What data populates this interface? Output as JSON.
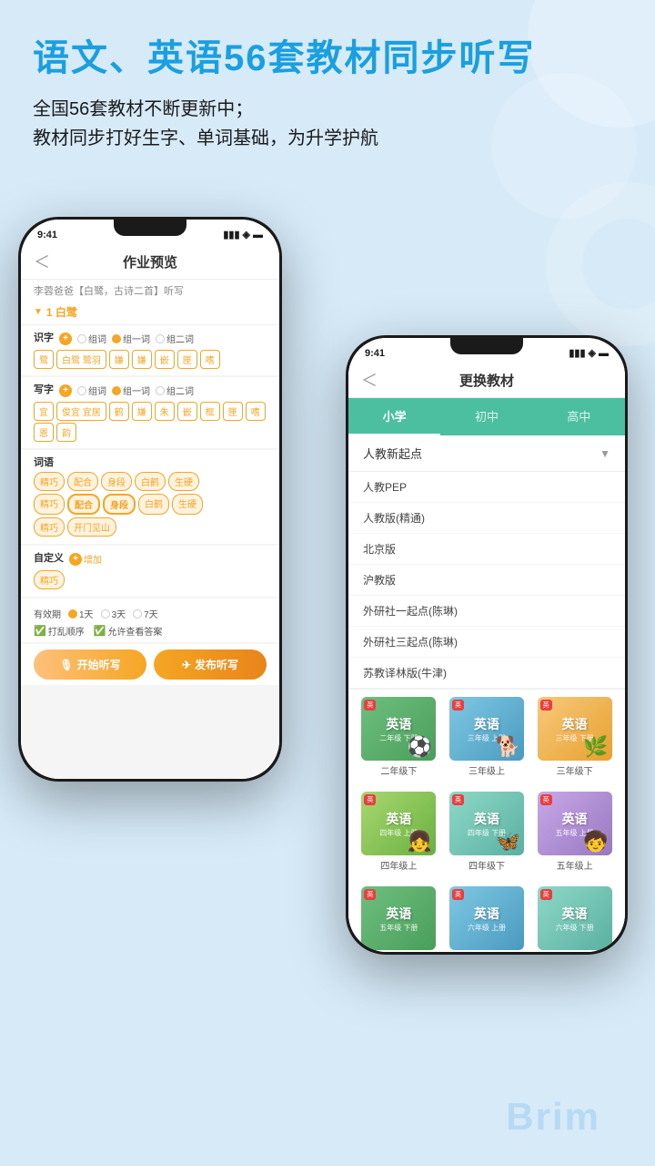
{
  "page": {
    "background": "#d6eaf8"
  },
  "header": {
    "main_title": "语文、英语56套教材同步听写",
    "sub_title_line1": "全国56套教材不断更新中；",
    "sub_title_line2": "教材同步打好生字、单词基础，为升学护航"
  },
  "left_phone": {
    "status": {
      "time": "9:41",
      "signal": "📶",
      "wifi": "WiFi",
      "battery": "🔋"
    },
    "nav": {
      "back": "＜",
      "title": "作业预览"
    },
    "subtitle": "李蓉爸爸【白鹭，古诗二首】听写",
    "section": {
      "arrow": "▼",
      "number": "1",
      "name": "白鹭"
    },
    "recognize": {
      "label": "识字",
      "options": [
        "组词",
        "组一词",
        "组二词"
      ],
      "chars": [
        "鹭",
        "白鹭 鹭羽",
        "嫌",
        "嫌",
        "嵌",
        "匣",
        "嗜"
      ],
      "chars2": [
        "鹭",
        "白鹭",
        "鹭羽",
        "嫌",
        "嫌",
        "嵌",
        "匣",
        "嗜"
      ]
    },
    "write": {
      "label": "写字",
      "options": [
        "组词",
        "组一词",
        "组二词"
      ],
      "chars": [
        "宜",
        "俊宜 宜居",
        "鹤",
        "嫌",
        "朱",
        "嵌",
        "框",
        "匣",
        "嗜"
      ],
      "chars2": [
        "恩",
        "韵"
      ]
    },
    "vocabulary": {
      "label": "词语",
      "tags_row1": [
        "精巧",
        "配合",
        "身段",
        "白鹤",
        "生硬"
      ],
      "tags_row2": [
        "精巧",
        "配合",
        "身段",
        "白鹤",
        "生硬"
      ],
      "tags_row3": [
        "精巧",
        "开门见山"
      ]
    },
    "custom": {
      "label": "自定义",
      "add_label": "增加",
      "tags": [
        "精巧"
      ]
    },
    "validity": {
      "label": "有效期",
      "options": [
        "1天",
        "3天",
        "7天"
      ]
    },
    "options": {
      "shuffle": "打乱顺序",
      "show_answer": "允许查看答案"
    },
    "buttons": {
      "start": "开始听写",
      "publish": "发布听写"
    }
  },
  "right_phone": {
    "status": {
      "time": "9:41",
      "signal": "📶",
      "wifi": "WiFi",
      "battery": "🔋"
    },
    "nav": {
      "back": "＜",
      "title": "更换教材"
    },
    "tabs": [
      "小学",
      "初中",
      "高中"
    ],
    "active_tab": 0,
    "selected_textbook": "人教新起点",
    "textbook_list": [
      "人教PEP",
      "人教版(精通)",
      "北京版",
      "沪教版",
      "外研社一起点(陈琳)",
      "外研社三起点(陈琳)",
      "苏教译林版(牛津)"
    ],
    "books": [
      {
        "grade": "二年级下",
        "color": "g2d"
      },
      {
        "grade": "三年级上",
        "color": "g3u"
      },
      {
        "grade": "三年级下",
        "color": "g3d"
      },
      {
        "grade": "四年级上",
        "color": "g4u"
      },
      {
        "grade": "四年级下",
        "color": "g4d"
      },
      {
        "grade": "五年级上",
        "color": "g5u"
      }
    ],
    "books_row2": [
      {
        "grade": "四年级上",
        "color": "g4u"
      },
      {
        "grade": "四年级下",
        "color": "g4d"
      },
      {
        "grade": "五年级上",
        "color": "g5u"
      }
    ]
  },
  "brim": {
    "label": "Brim"
  }
}
